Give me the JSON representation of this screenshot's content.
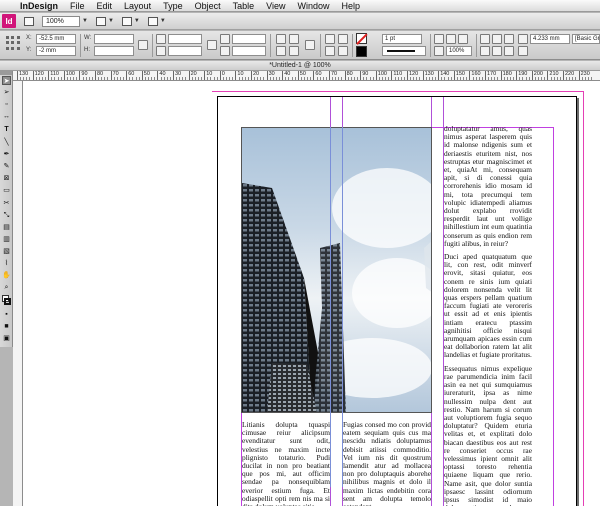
{
  "menubar": {
    "app": "InDesign",
    "items": [
      "File",
      "Edit",
      "Layout",
      "Type",
      "Object",
      "Table",
      "View",
      "Window",
      "Help"
    ]
  },
  "appbar": {
    "logo": "Id",
    "zoom": "100%"
  },
  "control": {
    "x_label": "X:",
    "x_value": "-52.5 mm",
    "y_label": "Y:",
    "y_value": "-2 mm",
    "w_label": "W:",
    "h_label": "H:",
    "stroke_weight": "1 pt",
    "opacity": "100%",
    "gutter_value": "4.233 mm",
    "style_field": "[Basic Grap"
  },
  "document": {
    "title": "*Untitled-1 @ 100%"
  },
  "ruler": {
    "labels": [
      "130",
      "120",
      "110",
      "100",
      "90",
      "80",
      "70",
      "60",
      "50",
      "40",
      "30",
      "20",
      "10",
      "0",
      "10",
      "20",
      "30",
      "40",
      "50",
      "60",
      "70",
      "80",
      "90",
      "100",
      "110",
      "120",
      "130",
      "140",
      "150",
      "160",
      "170",
      "180",
      "190",
      "200",
      "210",
      "220",
      "230"
    ]
  },
  "columns": {
    "left": "Litianis dolupta tquaspi cimusae reiur alicipsum evenditatur sunt odit, velestius ne maxim incte plignisto totaturio. Pudi ducilat in non pro beatiant que pos mi, aut officim sendae pa nonsequiblam everior estium fuga. Et odiaspellit opti rem nis ma si dita dolum voluptas sitis",
    "middle": "Fugias consed mo con provid eatem sequiam quis cus ma nescidu ndiatis doluptamus debisit atiissi commoditio. Vel ium nis dit quostrum lamendit atur ad mollacea non pro doluptaquis aborehe nihilibus magnis et dolo il maxim lictas endebitin cora sent am dolupta temolo eatendant",
    "right_p1": "doluptatatur amus, quas nimus asperat lasperem quis id malonse ndigenis sum et deriaestis eturitem nist, nos estruptas etur magniscimet et et, quiaAt mi, consequam apit, si di conessi quia corrorehenis idio mosam id mi, tota precumqui tem volupic idiatempedi aliamus dolut explabo rrovidit resperdit laut unt vollige nihillestium int eum quatintia conserum as quis endion rem fugiti alibus, in reiur?",
    "right_p2": "Duci aped quatquatum que lit, con rest, odit minverf erovit, sitasi quiatur, eos conem re sinis ium quiati dolorem nonsenda velit lit quas erspers pellam quatium faccum fugiati ate veroreris ut essit ad et enis ipientis intiam eratecu ptassim agnihitisi officie nisqui arumquam apicaes essin cum eat dollaborion ratem lat alit landelias et fugiate proritatus.",
    "right_p3": "Essequatus nimus expelique rae parumendicia inim facil asin ea net qui sumquiamus iureraturit, ipsa as nime nullessim nulpa dent aut restio. Nam harum si corum aut voluptiorem fugia sequo doluptatur? Quidem eturia velitas et, et explitati dolo biacan daestibus eos aut rest re conseriet occus rae velessimus ipient omnit alit optassi toresto rehentia quiaene liquam que rerio. Name asit, que dolor suntia ipsaesc lassint odiornum ipsus simodist id maio doloresecti bereper fernatusam dolorru ptures"
  },
  "colors": {
    "bleed": "#e43fb5",
    "margin_guide": "#c040e0",
    "frame_edge": "#7a8fd8",
    "logo": "#d1157a"
  },
  "icons": [
    "apple-icon",
    "selection-tool-icon",
    "direct-selection-icon",
    "type-tool-icon",
    "pen-tool-icon",
    "rectangle-frame-icon",
    "hand-tool-icon",
    "zoom-tool-icon",
    "fill-swatch-icon",
    "stroke-swatch-icon"
  ]
}
